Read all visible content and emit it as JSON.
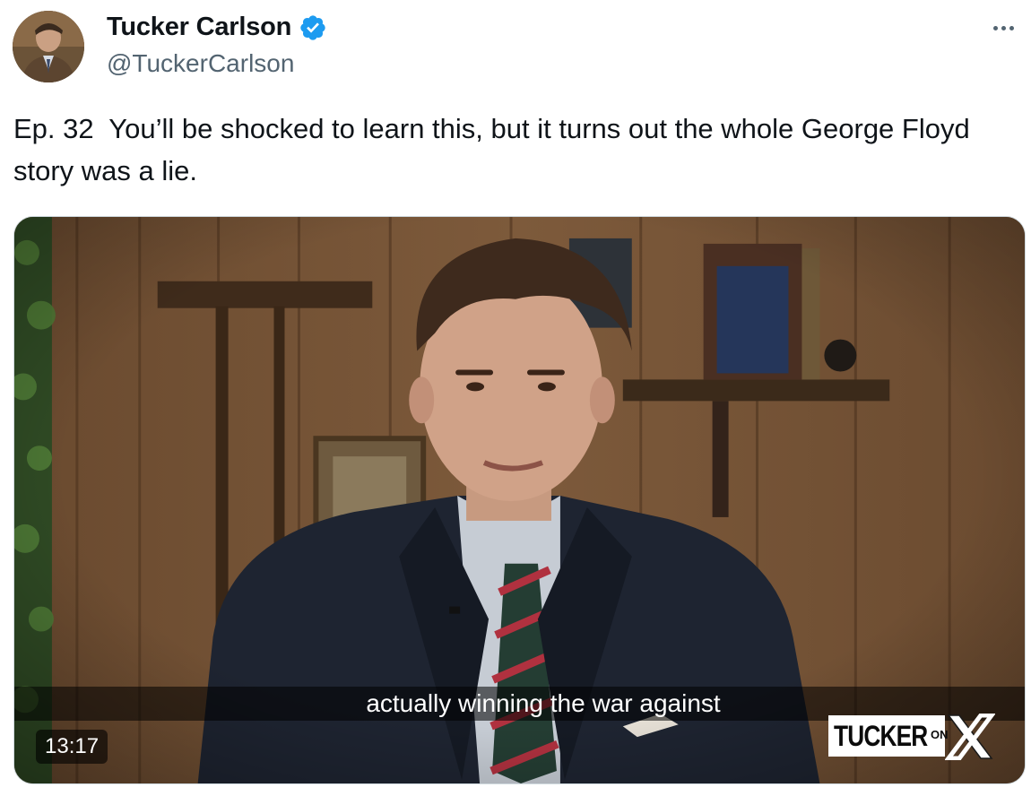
{
  "author": {
    "display_name": "Tucker Carlson",
    "handle": "@TuckerCarlson",
    "verified": true,
    "avatar_icon": "profile-photo"
  },
  "tweet": {
    "text": "Ep. 32  You’ll be shocked to learn this, but it turns out the whole George Floyd story was a lie."
  },
  "video": {
    "caption": "actually winning the war against",
    "duration": "13:17",
    "brand": {
      "word": "TUCKER",
      "small": "ON",
      "letter": "X"
    }
  },
  "colors": {
    "text_primary": "#0f1419",
    "text_secondary": "#536471",
    "verified": "#1d9bf0"
  },
  "icons": {
    "menu": "more-icon",
    "badge": "verified-badge-icon"
  }
}
